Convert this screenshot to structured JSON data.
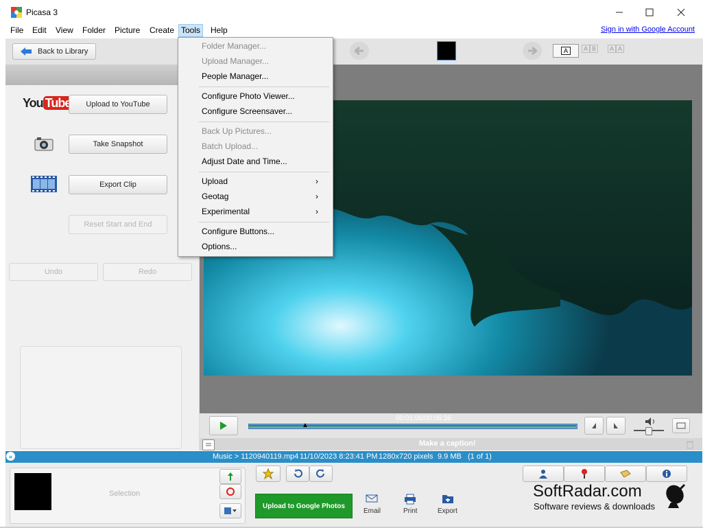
{
  "window": {
    "title": "Picasa 3"
  },
  "menu": {
    "items": [
      "File",
      "Edit",
      "View",
      "Folder",
      "Picture",
      "Create",
      "Tools",
      "Help"
    ],
    "signin": "Sign in with Google Account"
  },
  "tools_menu": {
    "items": [
      {
        "label": "Folder Manager...",
        "enabled": false
      },
      {
        "label": "Upload Manager...",
        "enabled": false
      },
      {
        "label": "People Manager...",
        "enabled": true
      },
      {
        "label": "Configure Photo Viewer...",
        "enabled": true
      },
      {
        "label": "Configure Screensaver...",
        "enabled": true
      },
      {
        "label": "Back Up Pictures...",
        "enabled": false
      },
      {
        "label": "Batch Upload...",
        "enabled": false
      },
      {
        "label": "Adjust Date and Time...",
        "enabled": true
      },
      {
        "label": "Upload",
        "enabled": true,
        "submenu": true
      },
      {
        "label": "Geotag",
        "enabled": true,
        "submenu": true
      },
      {
        "label": "Experimental",
        "enabled": true,
        "submenu": true
      },
      {
        "label": "Configure Buttons...",
        "enabled": true
      },
      {
        "label": "Options...",
        "enabled": true
      }
    ]
  },
  "left": {
    "back_label": "Back to Library",
    "youtube_logo": "YouTube",
    "upload_youtube": "Upload to YouTube",
    "take_snapshot": "Take Snapshot",
    "export_clip": "Export Clip",
    "reset": "Reset Start and End",
    "undo": "Undo",
    "redo": "Redo"
  },
  "player": {
    "time": "00:01:06/00:06:36",
    "caption_placeholder": "Make a caption!"
  },
  "status": {
    "path": "Music > 1120940119.mp4",
    "datetime": "11/10/2023 8:23:41 PM",
    "dims": "1280x720 pixels",
    "size": "9.9 MB",
    "count": "(1 of 1)"
  },
  "bottom": {
    "selection": "Selection",
    "upload_google": "Upload to Google Photos",
    "email": "Email",
    "print": "Print",
    "export": "Export"
  },
  "watermark": {
    "title": "SoftRadar.com",
    "subtitle": "Software reviews & downloads"
  },
  "colors": {
    "accent": "#2a8ec8",
    "upload_green": "#1f9a2a"
  }
}
